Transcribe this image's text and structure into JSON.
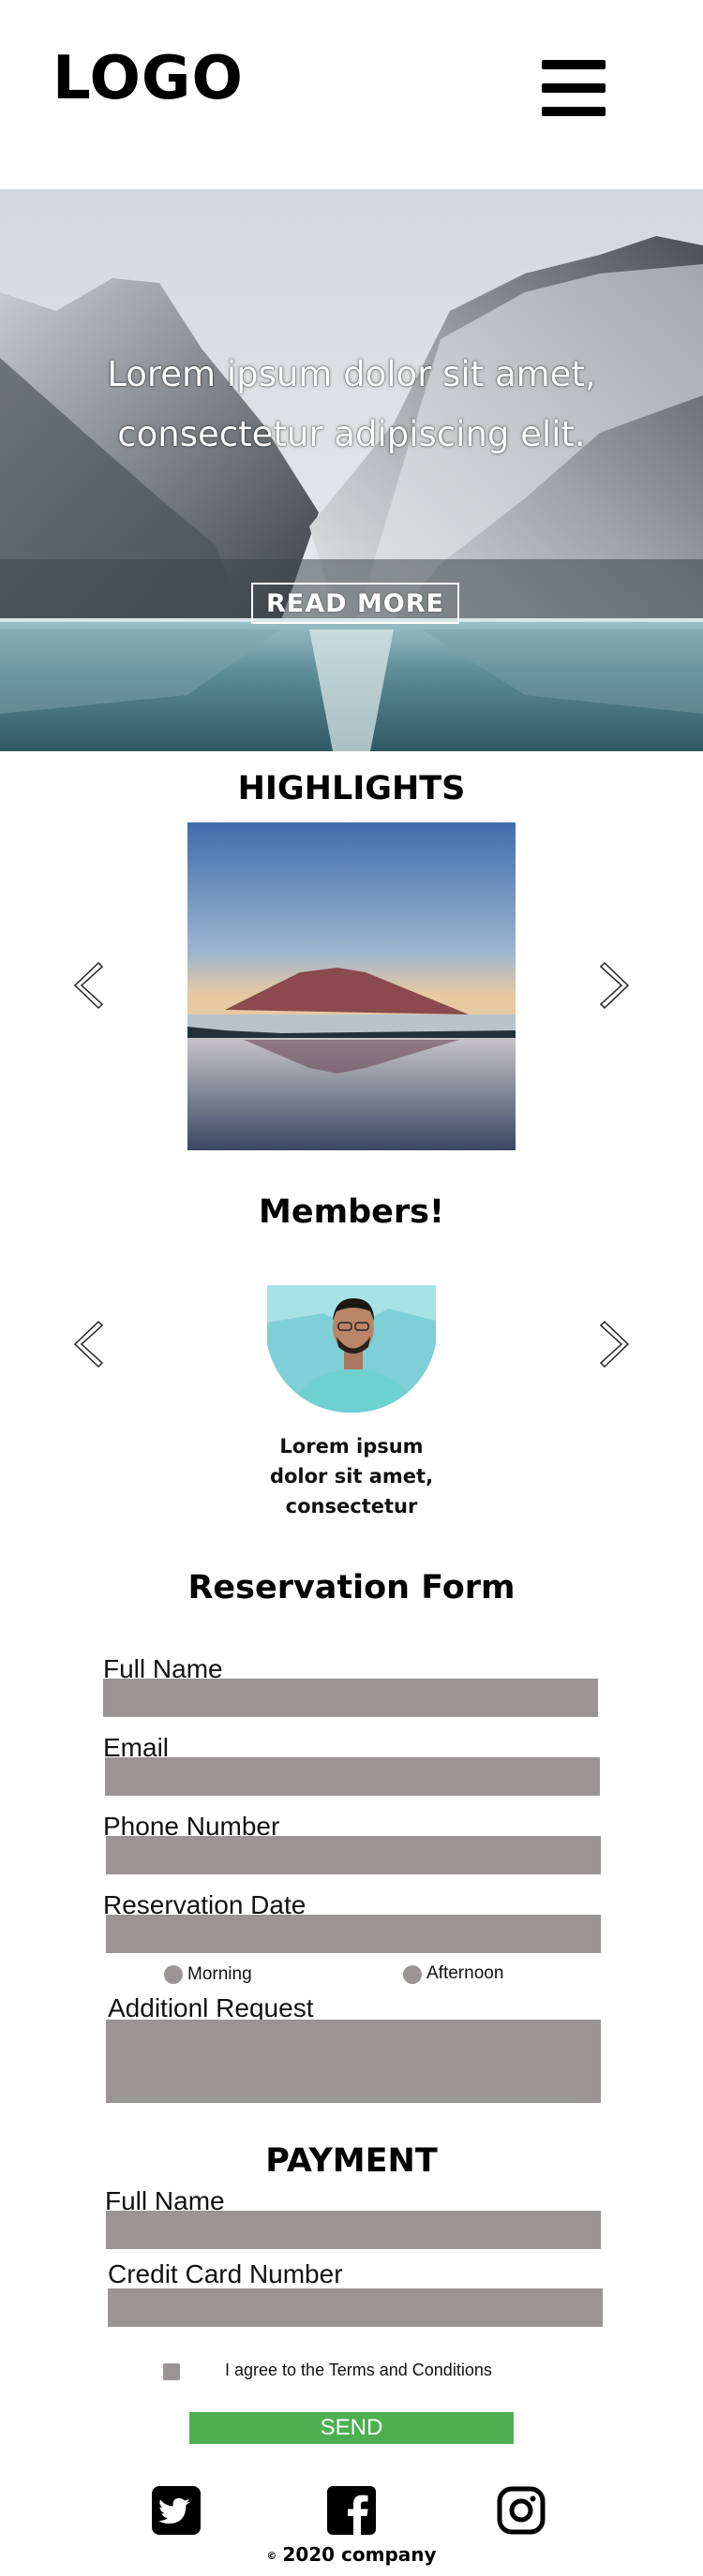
{
  "header": {
    "logo": "LOGO",
    "menu_icon": "hamburger-menu-icon"
  },
  "hero": {
    "line1": "Lorem ipsum dolor sit amet,",
    "line2": "consectetur adipiscing elit.",
    "button": "READ MORE"
  },
  "highlights": {
    "title": "HIGHLIGHTS",
    "prev_icon": "chevron-left-icon",
    "next_icon": "chevron-right-icon"
  },
  "members": {
    "title": "Members!",
    "bio": [
      "Lorem ipsum",
      "dolor sit amet,",
      "consectetur"
    ],
    "prev_icon": "chevron-left-icon",
    "next_icon": "chevron-right-icon"
  },
  "reservation": {
    "title": "Reservation Form",
    "full_name": "Full Name",
    "email": "Email",
    "phone": "Phone Number",
    "date": "Reservation Date",
    "morning": "Morning",
    "afternoon": "Afternoon",
    "request": "Additionl Request"
  },
  "payment": {
    "title": "PAYMENT",
    "full_name": "Full Name",
    "card": "Credit Card Number",
    "terms": "I agree to the Terms and Conditions",
    "send": "SEND"
  },
  "footer": {
    "icons": [
      "twitter-icon",
      "facebook-icon",
      "instagram-icon"
    ],
    "copyright_symbol": "©",
    "copyright": "2020 company"
  },
  "colors": {
    "field_gray": "#9a9595",
    "send_green": "#4caf50"
  }
}
